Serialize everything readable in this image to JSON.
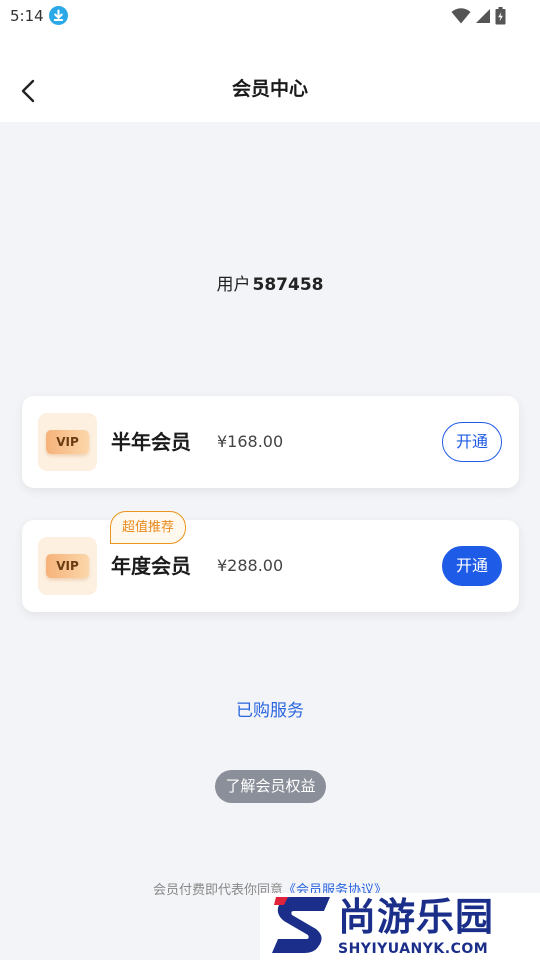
{
  "status_bar": {
    "time": "5:14",
    "icons": [
      "download-icon",
      "wifi-icon",
      "signal-icon",
      "battery-icon"
    ]
  },
  "nav": {
    "title": "会员中心",
    "back_icon": "chevron-left-icon"
  },
  "user": {
    "prefix": "用户",
    "id": "587458"
  },
  "plans": [
    {
      "badge": "VIP",
      "name": "半年会员",
      "price": "¥168.00",
      "button": "开通",
      "button_style": "outline"
    },
    {
      "badge": "VIP",
      "name": "年度会员",
      "price": "¥288.00",
      "button": "开通",
      "button_style": "filled",
      "tag": "超值推荐"
    }
  ],
  "purchased_link": "已购服务",
  "benefits_button": "了解会员权益",
  "agreement": {
    "text": "会员付费即代表你同意",
    "link": "《会员服务协议》"
  },
  "watermark": {
    "brand": "尚游乐园",
    "domain": "SHYIYUANYK.COM"
  },
  "colors": {
    "accent": "#1e5be6",
    "tag": "#e8941d",
    "vip_box": "#fdf0e0"
  }
}
